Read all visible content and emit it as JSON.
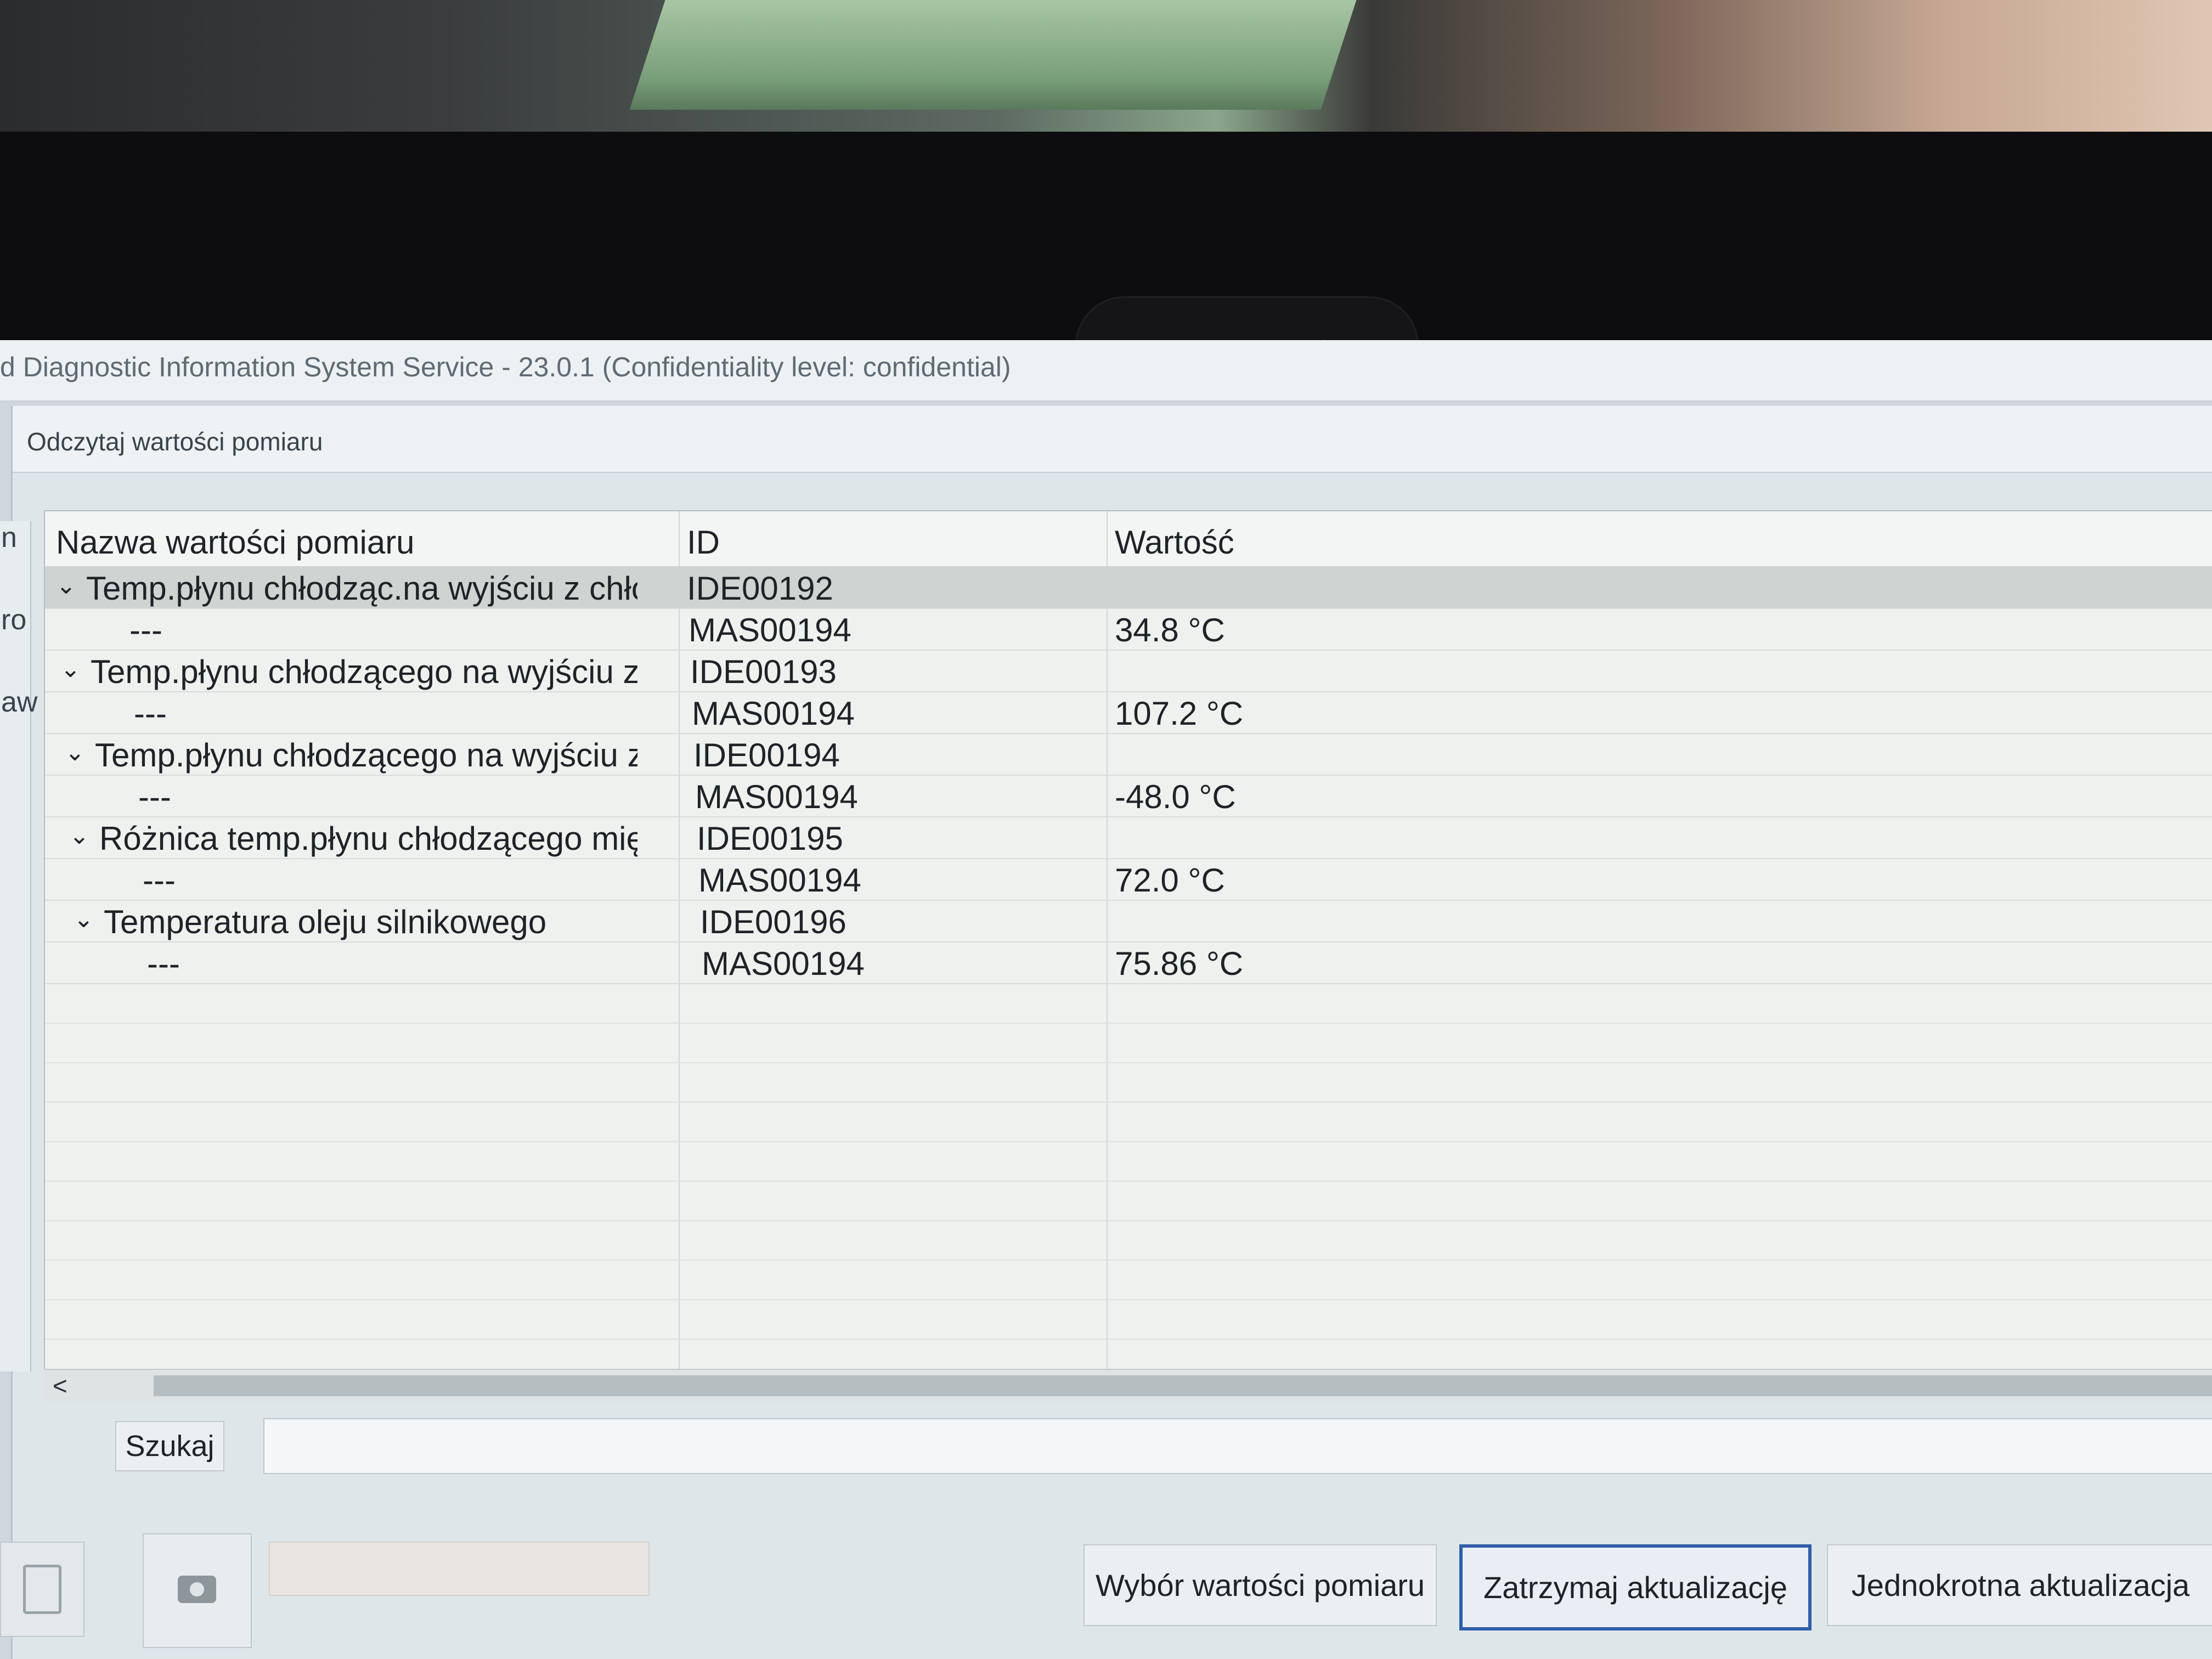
{
  "window": {
    "title": "d Diagnostic Information System Service - 23.0.1 (Confidentiality level: confidential)"
  },
  "dialog": {
    "title": "Odczytaj wartości pomiaru"
  },
  "side_fragments": [
    "n",
    "ro",
    "aw"
  ],
  "table": {
    "columns": [
      "Nazwa wartości pomiaru",
      "ID",
      "Wartość"
    ],
    "rows": [
      {
        "name": "Temp.płynu chłodząc.na wyjściu z chło",
        "id": "IDE00192",
        "value": "",
        "type": "group",
        "selected": true
      },
      {
        "name": "---",
        "id": "MAS00194",
        "value": "34.8 °C",
        "type": "child"
      },
      {
        "name": "Temp.płynu chłodzącego na wyjściu z s",
        "id": "IDE00193",
        "value": "",
        "type": "group"
      },
      {
        "name": "---",
        "id": "MAS00194",
        "value": "107.2 °C",
        "type": "child"
      },
      {
        "name": "Temp.płynu chłodzącego na wyjściu z c",
        "id": "IDE00194",
        "value": "",
        "type": "group"
      },
      {
        "name": "---",
        "id": "MAS00194",
        "value": "-48.0 °C",
        "type": "child"
      },
      {
        "name": "Różnica temp.płynu chłodzącego międz",
        "id": "IDE00195",
        "value": "",
        "type": "group"
      },
      {
        "name": "---",
        "id": "MAS00194",
        "value": "72.0 °C",
        "type": "child"
      },
      {
        "name": "Temperatura oleju silnikowego",
        "id": "IDE00196",
        "value": "",
        "type": "group"
      },
      {
        "name": "---",
        "id": "MAS00194",
        "value": "75.86 °C",
        "type": "child"
      }
    ],
    "expand_icon": "chevron-down-icon"
  },
  "scrollbar": {
    "left_arrow": "<"
  },
  "search": {
    "label": "Szukaj",
    "value": ""
  },
  "toolbar": {
    "camera_icon": "camera-icon",
    "document_icon": "document-icon",
    "buttons": [
      {
        "label": "Wybór wartości pomiaru",
        "active": false
      },
      {
        "label": "Zatrzymaj aktualizację",
        "active": true
      },
      {
        "label": "Jednokrotna aktualizacja",
        "active": false
      }
    ]
  },
  "colors": {
    "selected_row": "#cfd3d2",
    "active_button_border": "#2e5ea8"
  }
}
